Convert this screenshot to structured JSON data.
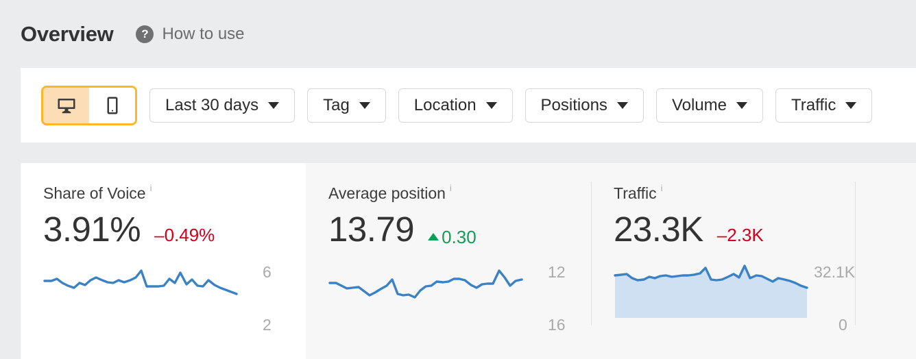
{
  "header": {
    "title": "Overview",
    "help_icon": "question-mark-circle-icon",
    "how_to_use_label": "How to use"
  },
  "toolbar": {
    "device_toggle": {
      "options": [
        {
          "name": "desktop-icon",
          "label": "Desktop",
          "selected": true
        },
        {
          "name": "mobile-icon",
          "label": "Mobile",
          "selected": false
        }
      ],
      "border_color": "#fdb72a",
      "active_fill": "#fdddb5"
    },
    "filters": [
      {
        "label": "Last 30 days",
        "icon": "chevron-down-icon"
      },
      {
        "label": "Tag",
        "icon": "chevron-down-icon"
      },
      {
        "label": "Location",
        "icon": "chevron-down-icon"
      },
      {
        "label": "Positions",
        "icon": "chevron-down-icon"
      },
      {
        "label": "Volume",
        "icon": "chevron-down-icon"
      },
      {
        "label": "Traffic",
        "icon": "chevron-down-icon"
      }
    ]
  },
  "cards": [
    {
      "title": "Share of Voice",
      "info": "i",
      "value": "3.91%",
      "delta": "–0.49%",
      "delta_direction": "negative",
      "axis_top": "6",
      "axis_bottom": "2"
    },
    {
      "title": "Average position",
      "info": "i",
      "value": "13.79",
      "delta": "0.30",
      "delta_direction": "positive",
      "axis_top": "12",
      "axis_bottom": "16"
    },
    {
      "title": "Traffic",
      "info": "i",
      "value": "23.3K",
      "delta": "–2.3K",
      "delta_direction": "negative",
      "axis_top": "32.1K",
      "axis_bottom": "0"
    }
  ],
  "colors": {
    "page_background": "#ebeced",
    "panel_background": "#ffffff",
    "card_alt_background": "#f7f7f7",
    "line": "#3b82c4",
    "area_fill": "#cfe0f2",
    "negative": "#d0021b",
    "positive": "#0f9d58",
    "accent": "#fdb72a"
  },
  "chart_data": [
    {
      "type": "line",
      "title": "Share of Voice",
      "ylabel": "",
      "ylim": [
        2,
        6
      ],
      "tick_labels": [
        "6",
        "2"
      ],
      "values": [
        4.55,
        4.55,
        4.7,
        4.45,
        4.3,
        4.2,
        4.45,
        4.35,
        4.6,
        4.75,
        4.6,
        4.5,
        4.45,
        4.6,
        4.5,
        4.6,
        4.75,
        5.1,
        4.25,
        4.25,
        4.25,
        4.3,
        4.65,
        4.45,
        5.0,
        4.4,
        4.65,
        4.3,
        4.25,
        4.6,
        4.35,
        4.2,
        4.1,
        4.0,
        3.91
      ],
      "grid": false
    },
    {
      "type": "line",
      "title": "Average position",
      "ylabel": "",
      "ylim": [
        16,
        12
      ],
      "tick_labels": [
        "12",
        "16"
      ],
      "values": [
        13.9,
        13.95,
        14.1,
        14.25,
        14.2,
        14.15,
        14.4,
        14.65,
        14.5,
        14.3,
        14.1,
        13.75,
        14.55,
        14.65,
        14.6,
        14.8,
        14.4,
        14.15,
        14.1,
        13.85,
        13.9,
        13.85,
        13.7,
        13.7,
        13.75,
        14.05,
        14.2,
        14.0,
        13.95,
        13.95,
        13.2,
        13.6,
        14.1,
        13.85,
        13.79
      ],
      "grid": false
    },
    {
      "type": "area",
      "title": "Traffic",
      "ylabel": "",
      "ylim": [
        0,
        32100
      ],
      "tick_labels": [
        "32.1K",
        "0"
      ],
      "values": [
        26800,
        26900,
        26950,
        26500,
        26300,
        26350,
        26600,
        26500,
        26700,
        26750,
        26600,
        26650,
        26700,
        26750,
        26800,
        26900,
        27800,
        26300,
        26250,
        26300,
        26600,
        26850,
        26550,
        28200,
        26650,
        26900,
        26850,
        26500,
        26200,
        26600,
        26500,
        26350,
        26100,
        25800,
        23300
      ],
      "grid": false
    }
  ]
}
